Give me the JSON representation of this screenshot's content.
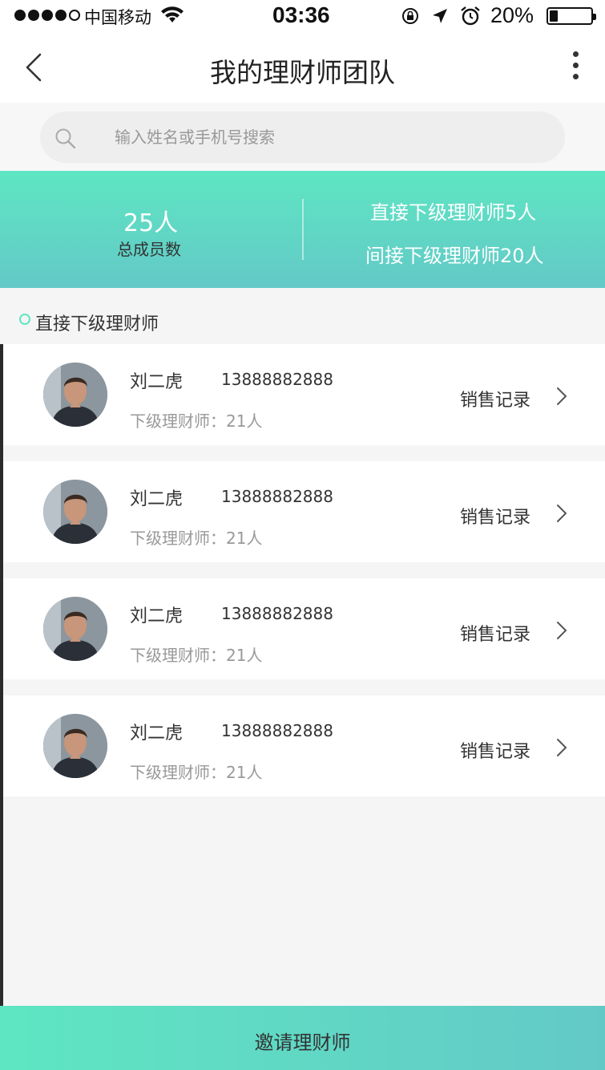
{
  "status_bar": {
    "carrier": "中国移动",
    "time": "03:36",
    "battery_percent": "20%",
    "battery_level": 0.2,
    "signal_dots_filled": 4,
    "signal_dots_total": 5,
    "icons": [
      "wifi-icon",
      "rotation-lock-icon",
      "location-arrow-icon",
      "alarm-icon",
      "battery-icon"
    ]
  },
  "nav": {
    "title": "我的理财师团队",
    "back_icon": "chevron-left-icon",
    "more_icon": "more-vertical-icon"
  },
  "search": {
    "placeholder": "输入姓名或手机号搜索",
    "icon": "search-icon"
  },
  "stats": {
    "total_value": "25人",
    "total_label": "总成员数",
    "direct": "直接下级理财师5人",
    "indirect": "间接下级理财师20人"
  },
  "section": {
    "title": "直接下级理财师"
  },
  "members": [
    {
      "name": "刘二虎",
      "phone": "13888882888",
      "sub_count": "下级理财师：21人",
      "action": "销售记录"
    },
    {
      "name": "刘二虎",
      "phone": "13888882888",
      "sub_count": "下级理财师：21人",
      "action": "销售记录"
    },
    {
      "name": "刘二虎",
      "phone": "13888882888",
      "sub_count": "下级理财师：21人",
      "action": "销售记录"
    },
    {
      "name": "刘二虎",
      "phone": "13888882888",
      "sub_count": "下级理财师：21人",
      "action": "销售记录"
    }
  ],
  "footer": {
    "invite_label": "邀请理财师"
  },
  "colors": {
    "accent_start": "#5ee6c2",
    "accent_end": "#63c9c7",
    "text_primary": "#333333",
    "text_secondary": "#999999",
    "white": "#ffffff"
  }
}
